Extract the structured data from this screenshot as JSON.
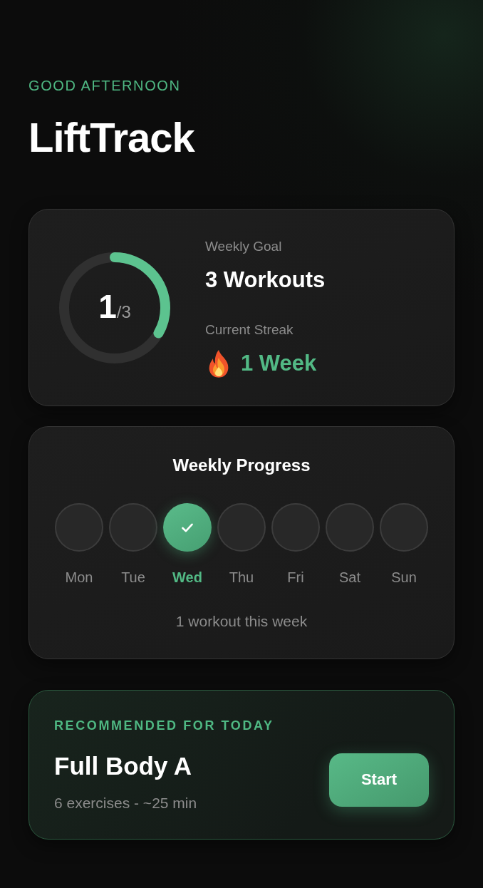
{
  "header": {
    "greeting": "GOOD AFTERNOON",
    "title": "LiftTrack"
  },
  "summary": {
    "ring": {
      "count": "1",
      "total": "/3",
      "level": 0.333
    },
    "goal_label": "Weekly Goal",
    "goal_value": "3 Workouts",
    "streak_label": "Current Streak",
    "streak_value": "1 Week"
  },
  "weekly_progress": {
    "title": "Weekly Progress",
    "days": [
      {
        "label": "Mon",
        "checked": false
      },
      {
        "label": "Tue",
        "checked": false
      },
      {
        "label": "Wed",
        "checked": true
      },
      {
        "label": "Thu",
        "checked": false
      },
      {
        "label": "Fri",
        "checked": false
      },
      {
        "label": "Sat",
        "checked": false
      },
      {
        "label": "Sun",
        "checked": false
      }
    ],
    "summary": "1 workout this week"
  },
  "recommendation": {
    "eyebrow": "RECOMMENDED FOR TODAY",
    "name": "Full Body A",
    "meta": "6 exercises - ~25 min",
    "button": "Start"
  }
}
